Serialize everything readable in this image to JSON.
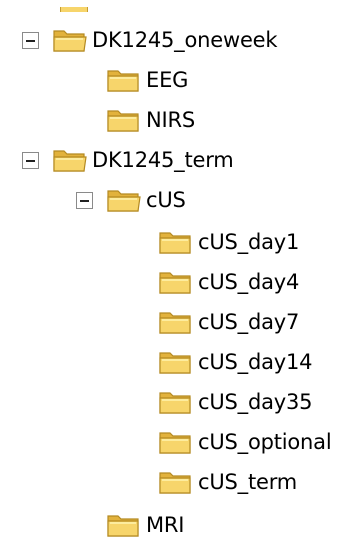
{
  "tree": {
    "items": [
      {
        "label": "DK1245_oneweek",
        "icon": "folder-open-icon",
        "expanded": true
      },
      {
        "label": "EEG",
        "icon": "folder-icon"
      },
      {
        "label": "NIRS",
        "icon": "folder-icon"
      },
      {
        "label": "DK1245_term",
        "icon": "folder-open-icon",
        "expanded": true
      },
      {
        "label": "cUS",
        "icon": "folder-open-icon",
        "expanded": true
      },
      {
        "label": "cUS_day1",
        "icon": "folder-icon"
      },
      {
        "label": "cUS_day4",
        "icon": "folder-icon"
      },
      {
        "label": "cUS_day7",
        "icon": "folder-icon"
      },
      {
        "label": "cUS_day14",
        "icon": "folder-icon"
      },
      {
        "label": "cUS_day35",
        "icon": "folder-icon"
      },
      {
        "label": "cUS_optional",
        "icon": "folder-icon"
      },
      {
        "label": "cUS_term",
        "icon": "folder-icon"
      },
      {
        "label": "MRI",
        "icon": "folder-icon"
      }
    ]
  },
  "colors": {
    "folder_fill": "#f7d56b",
    "folder_shade": "#e2b23c",
    "folder_outline": "#b48a22",
    "toggle_border": "#8a8a8a"
  }
}
